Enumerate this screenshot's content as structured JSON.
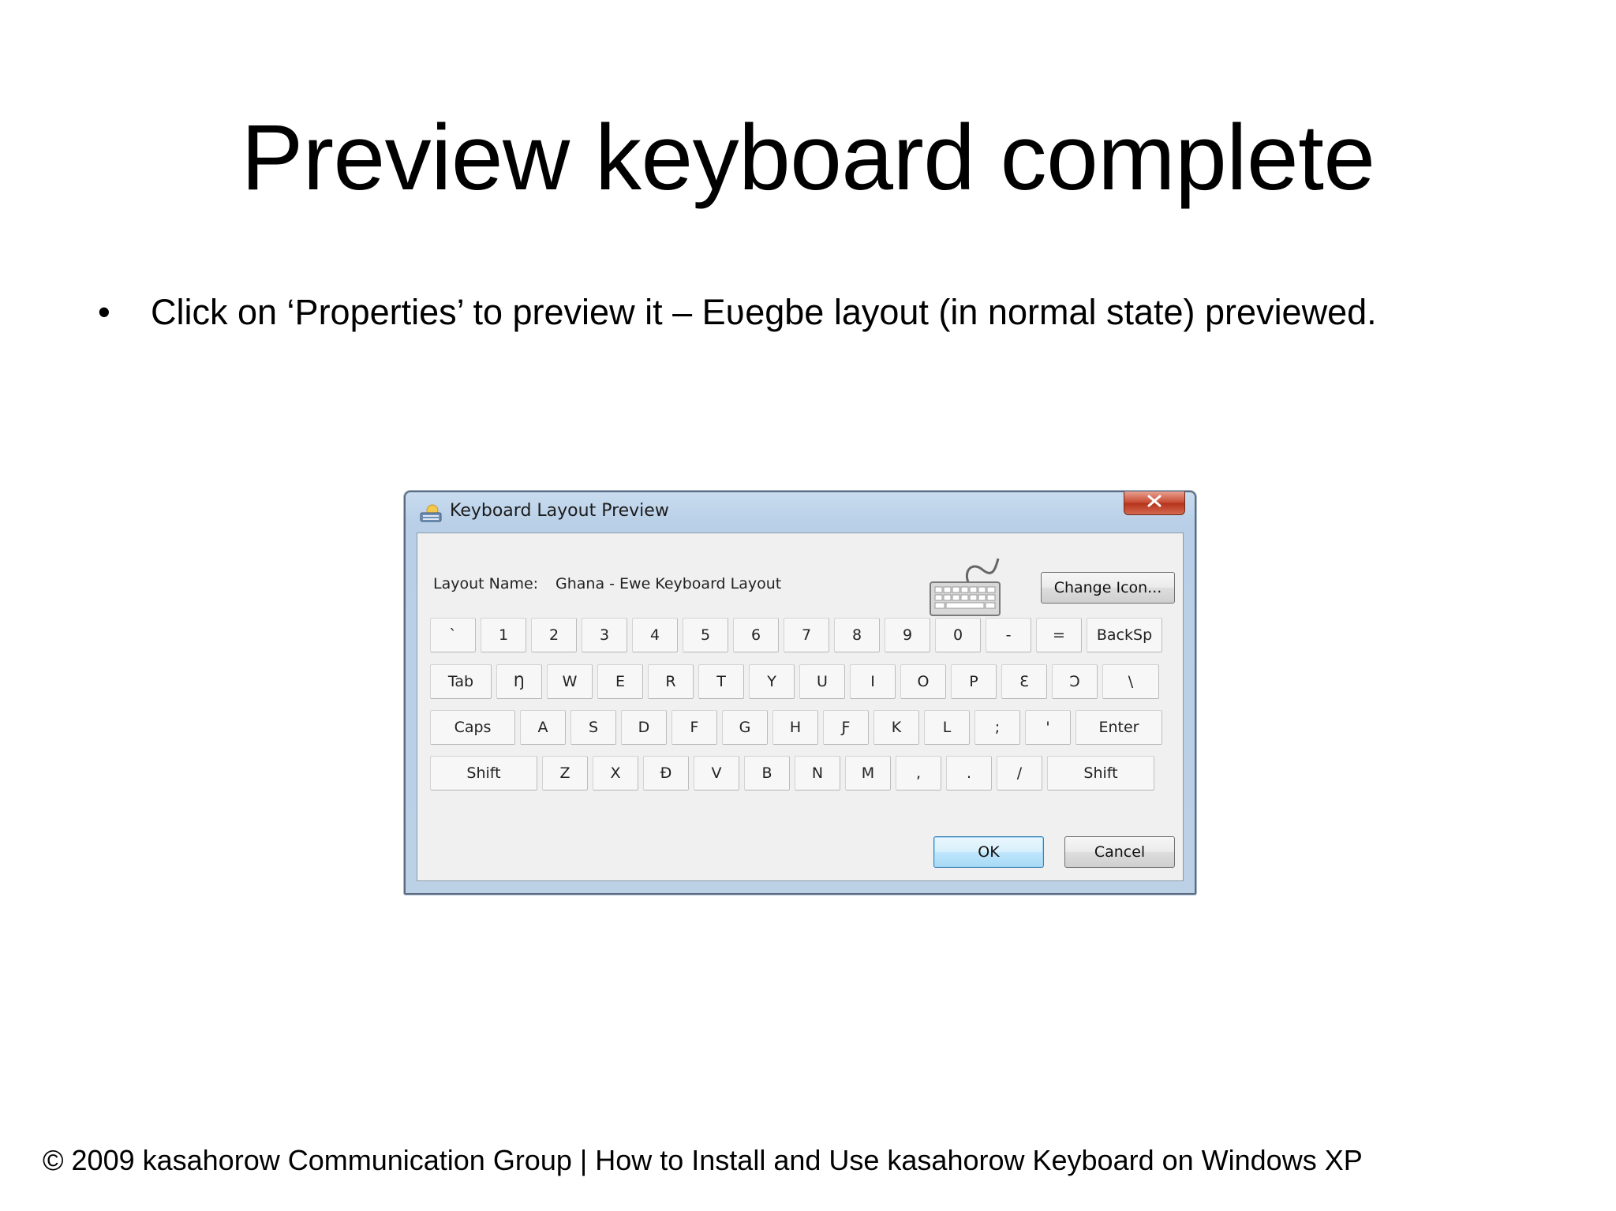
{
  "slide": {
    "title": "Preview keyboard complete",
    "bullet": "Click on ‘Properties’ to preview it – Eʋegbe layout (in normal state) previewed.",
    "footer": "© 2009 kasahorow Communication Group | How to Install and Use kasahorow Keyboard on Windows XP"
  },
  "dialog": {
    "title": "Keyboard Layout Preview",
    "close_glyph": "x",
    "layout_name_label": "Layout Name:",
    "layout_name_value": "Ghana - Ewe Keyboard Layout",
    "change_icon_label": "Change Icon...",
    "ok_label": "OK",
    "cancel_label": "Cancel",
    "rows": [
      [
        "`",
        "1",
        "2",
        "3",
        "4",
        "5",
        "6",
        "7",
        "8",
        "9",
        "0",
        "-",
        "=",
        "BackSp"
      ],
      [
        "Tab",
        "Ŋ",
        "W",
        "E",
        "R",
        "T",
        "Y",
        "U",
        "I",
        "O",
        "P",
        "Ɛ",
        "Ɔ",
        "\\"
      ],
      [
        "Caps",
        "A",
        "S",
        "D",
        "F",
        "G",
        "H",
        "Ƒ",
        "K",
        "L",
        ";",
        "'",
        "Enter"
      ],
      [
        "Shift",
        "Z",
        "X",
        "Ɖ",
        "V",
        "B",
        "N",
        "M",
        ",",
        ".",
        "/",
        "Shift"
      ]
    ]
  },
  "icons": {
    "title_icon": "keyboard-app-icon",
    "close": "close-icon",
    "layout_icon": "keyboard-icon"
  }
}
